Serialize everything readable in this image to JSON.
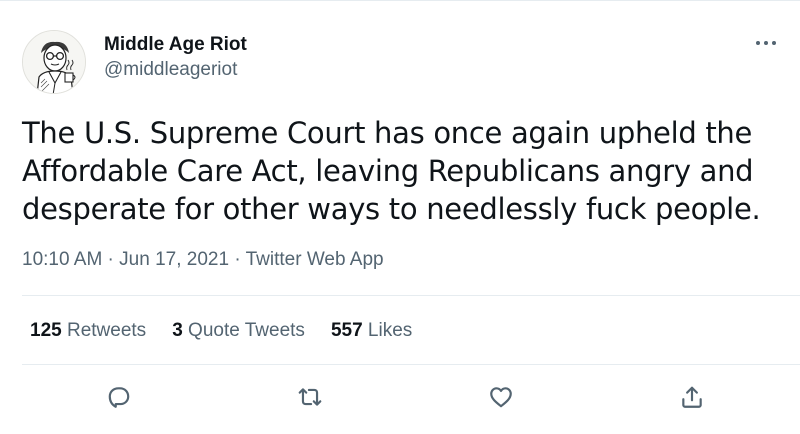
{
  "author": {
    "display_name": "Middle Age Riot",
    "handle": "@middleageriot"
  },
  "tweet": {
    "text": "The U.S. Supreme Court has once again upheld the Affordable Care Act, leaving Republicans angry and desperate for other ways to needlessly fuck people.",
    "time": "10:10 AM",
    "separator": " · ",
    "date": "Jun 17, 2021",
    "source": "Twitter Web App"
  },
  "stats": {
    "retweets_count": "125",
    "retweets_label": " Retweets",
    "quotes_count": "3",
    "quotes_label": " Quote Tweets",
    "likes_count": "557",
    "likes_label": " Likes"
  },
  "icons": {
    "more": "more-dots-icon",
    "reply": "reply-icon",
    "retweet": "retweet-icon",
    "like": "heart-icon",
    "share": "share-icon"
  },
  "colors": {
    "text": "#0f1419",
    "secondary": "#536471",
    "divider": "#e6ecf0"
  }
}
